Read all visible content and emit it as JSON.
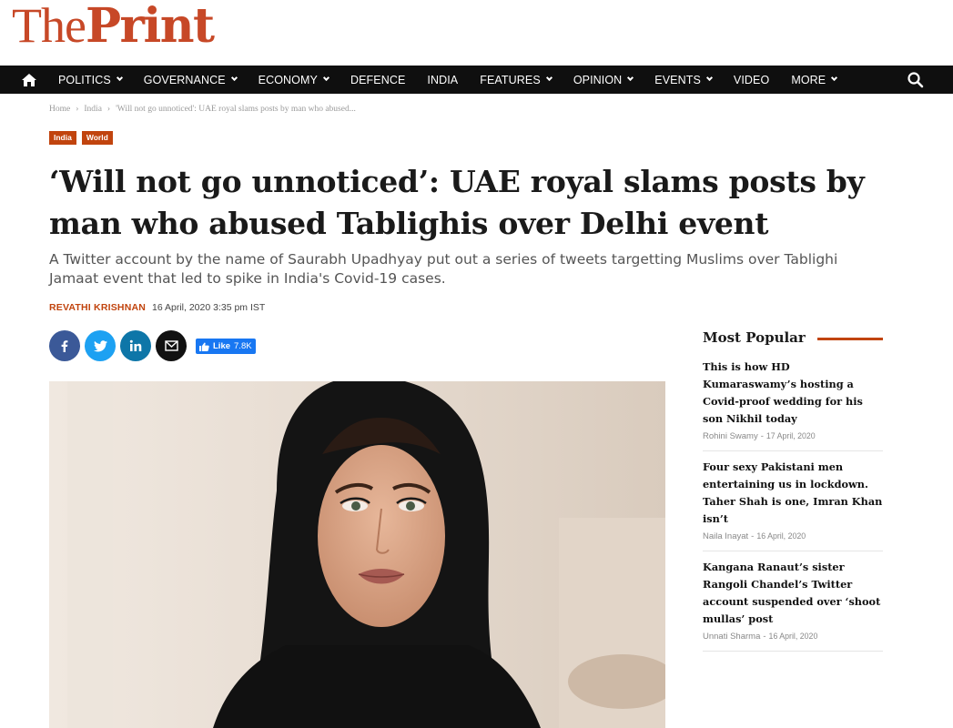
{
  "brand": {
    "logo_the": "The",
    "logo_print": "Print",
    "accent": "#c74827"
  },
  "nav": {
    "items": [
      {
        "label": "POLITICS",
        "dropdown": true
      },
      {
        "label": "GOVERNANCE",
        "dropdown": true
      },
      {
        "label": "ECONOMY",
        "dropdown": true
      },
      {
        "label": "DEFENCE",
        "dropdown": false
      },
      {
        "label": "INDIA",
        "dropdown": false
      },
      {
        "label": "FEATURES",
        "dropdown": true
      },
      {
        "label": "OPINION",
        "dropdown": true
      },
      {
        "label": "EVENTS",
        "dropdown": true
      },
      {
        "label": "VIDEO",
        "dropdown": false
      },
      {
        "label": "MORE",
        "dropdown": true
      }
    ]
  },
  "breadcrumb": {
    "home": "Home",
    "section": "India",
    "current": "'Will not go unnoticed': UAE royal slams posts by man who abused..."
  },
  "tags": [
    "India",
    "World"
  ],
  "article": {
    "headline": "‘Will not go unnoticed’: UAE royal slams posts by man who abused Tablighis over Delhi event",
    "subhead": "A Twitter account by the name of Saurabh Upadhyay put out a series of tweets targetting Muslims over Tablighi Jamaat event that led to spike in India's Covid-19 cases.",
    "author": "REVATHI KRISHNAN",
    "date": "16 April, 2020 3:35 pm IST"
  },
  "share": {
    "like_label": "Like",
    "like_count": "7.8K"
  },
  "sidebar": {
    "title": "Most Popular",
    "items": [
      {
        "title": "This is how HD Kumaraswamy’s hosting a Covid-proof wedding for his son Nikhil today",
        "author": "Rohini Swamy",
        "date": "17 April, 2020"
      },
      {
        "title": "Four sexy Pakistani men entertaining us in lockdown. Taher Shah is one, Imran Khan isn’t",
        "author": "Naila Inayat",
        "date": "16 April, 2020"
      },
      {
        "title": "Kangana Ranaut’s sister Rangoli Chandel’s Twitter account suspended over ‘shoot mullas’ post",
        "author": "Unnati Sharma",
        "date": "16 April, 2020"
      }
    ]
  }
}
